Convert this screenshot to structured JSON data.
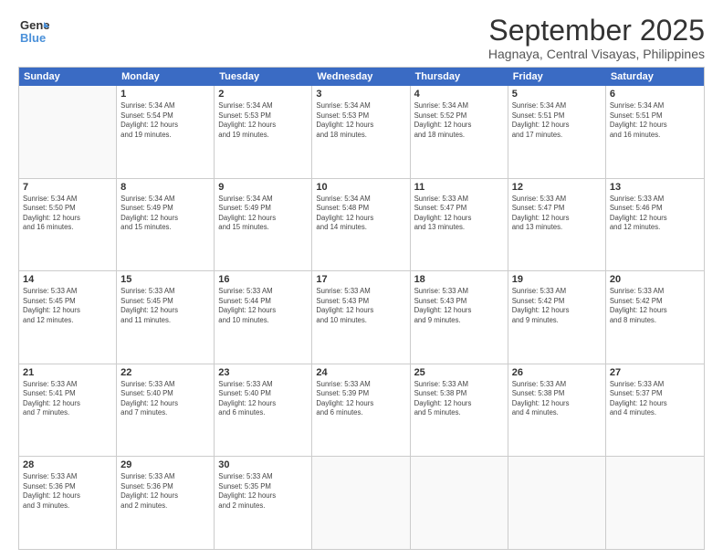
{
  "logo": {
    "line1": "General",
    "line2": "Blue"
  },
  "title": "September 2025",
  "subtitle": "Hagnaya, Central Visayas, Philippines",
  "days": [
    "Sunday",
    "Monday",
    "Tuesday",
    "Wednesday",
    "Thursday",
    "Friday",
    "Saturday"
  ],
  "weeks": [
    [
      {
        "day": "",
        "info": ""
      },
      {
        "day": "1",
        "info": "Sunrise: 5:34 AM\nSunset: 5:54 PM\nDaylight: 12 hours\nand 19 minutes."
      },
      {
        "day": "2",
        "info": "Sunrise: 5:34 AM\nSunset: 5:53 PM\nDaylight: 12 hours\nand 19 minutes."
      },
      {
        "day": "3",
        "info": "Sunrise: 5:34 AM\nSunset: 5:53 PM\nDaylight: 12 hours\nand 18 minutes."
      },
      {
        "day": "4",
        "info": "Sunrise: 5:34 AM\nSunset: 5:52 PM\nDaylight: 12 hours\nand 18 minutes."
      },
      {
        "day": "5",
        "info": "Sunrise: 5:34 AM\nSunset: 5:51 PM\nDaylight: 12 hours\nand 17 minutes."
      },
      {
        "day": "6",
        "info": "Sunrise: 5:34 AM\nSunset: 5:51 PM\nDaylight: 12 hours\nand 16 minutes."
      }
    ],
    [
      {
        "day": "7",
        "info": "Sunrise: 5:34 AM\nSunset: 5:50 PM\nDaylight: 12 hours\nand 16 minutes."
      },
      {
        "day": "8",
        "info": "Sunrise: 5:34 AM\nSunset: 5:49 PM\nDaylight: 12 hours\nand 15 minutes."
      },
      {
        "day": "9",
        "info": "Sunrise: 5:34 AM\nSunset: 5:49 PM\nDaylight: 12 hours\nand 15 minutes."
      },
      {
        "day": "10",
        "info": "Sunrise: 5:34 AM\nSunset: 5:48 PM\nDaylight: 12 hours\nand 14 minutes."
      },
      {
        "day": "11",
        "info": "Sunrise: 5:33 AM\nSunset: 5:47 PM\nDaylight: 12 hours\nand 13 minutes."
      },
      {
        "day": "12",
        "info": "Sunrise: 5:33 AM\nSunset: 5:47 PM\nDaylight: 12 hours\nand 13 minutes."
      },
      {
        "day": "13",
        "info": "Sunrise: 5:33 AM\nSunset: 5:46 PM\nDaylight: 12 hours\nand 12 minutes."
      }
    ],
    [
      {
        "day": "14",
        "info": "Sunrise: 5:33 AM\nSunset: 5:45 PM\nDaylight: 12 hours\nand 12 minutes."
      },
      {
        "day": "15",
        "info": "Sunrise: 5:33 AM\nSunset: 5:45 PM\nDaylight: 12 hours\nand 11 minutes."
      },
      {
        "day": "16",
        "info": "Sunrise: 5:33 AM\nSunset: 5:44 PM\nDaylight: 12 hours\nand 10 minutes."
      },
      {
        "day": "17",
        "info": "Sunrise: 5:33 AM\nSunset: 5:43 PM\nDaylight: 12 hours\nand 10 minutes."
      },
      {
        "day": "18",
        "info": "Sunrise: 5:33 AM\nSunset: 5:43 PM\nDaylight: 12 hours\nand 9 minutes."
      },
      {
        "day": "19",
        "info": "Sunrise: 5:33 AM\nSunset: 5:42 PM\nDaylight: 12 hours\nand 9 minutes."
      },
      {
        "day": "20",
        "info": "Sunrise: 5:33 AM\nSunset: 5:42 PM\nDaylight: 12 hours\nand 8 minutes."
      }
    ],
    [
      {
        "day": "21",
        "info": "Sunrise: 5:33 AM\nSunset: 5:41 PM\nDaylight: 12 hours\nand 7 minutes."
      },
      {
        "day": "22",
        "info": "Sunrise: 5:33 AM\nSunset: 5:40 PM\nDaylight: 12 hours\nand 7 minutes."
      },
      {
        "day": "23",
        "info": "Sunrise: 5:33 AM\nSunset: 5:40 PM\nDaylight: 12 hours\nand 6 minutes."
      },
      {
        "day": "24",
        "info": "Sunrise: 5:33 AM\nSunset: 5:39 PM\nDaylight: 12 hours\nand 6 minutes."
      },
      {
        "day": "25",
        "info": "Sunrise: 5:33 AM\nSunset: 5:38 PM\nDaylight: 12 hours\nand 5 minutes."
      },
      {
        "day": "26",
        "info": "Sunrise: 5:33 AM\nSunset: 5:38 PM\nDaylight: 12 hours\nand 4 minutes."
      },
      {
        "day": "27",
        "info": "Sunrise: 5:33 AM\nSunset: 5:37 PM\nDaylight: 12 hours\nand 4 minutes."
      }
    ],
    [
      {
        "day": "28",
        "info": "Sunrise: 5:33 AM\nSunset: 5:36 PM\nDaylight: 12 hours\nand 3 minutes."
      },
      {
        "day": "29",
        "info": "Sunrise: 5:33 AM\nSunset: 5:36 PM\nDaylight: 12 hours\nand 2 minutes."
      },
      {
        "day": "30",
        "info": "Sunrise: 5:33 AM\nSunset: 5:35 PM\nDaylight: 12 hours\nand 2 minutes."
      },
      {
        "day": "",
        "info": ""
      },
      {
        "day": "",
        "info": ""
      },
      {
        "day": "",
        "info": ""
      },
      {
        "day": "",
        "info": ""
      }
    ]
  ]
}
